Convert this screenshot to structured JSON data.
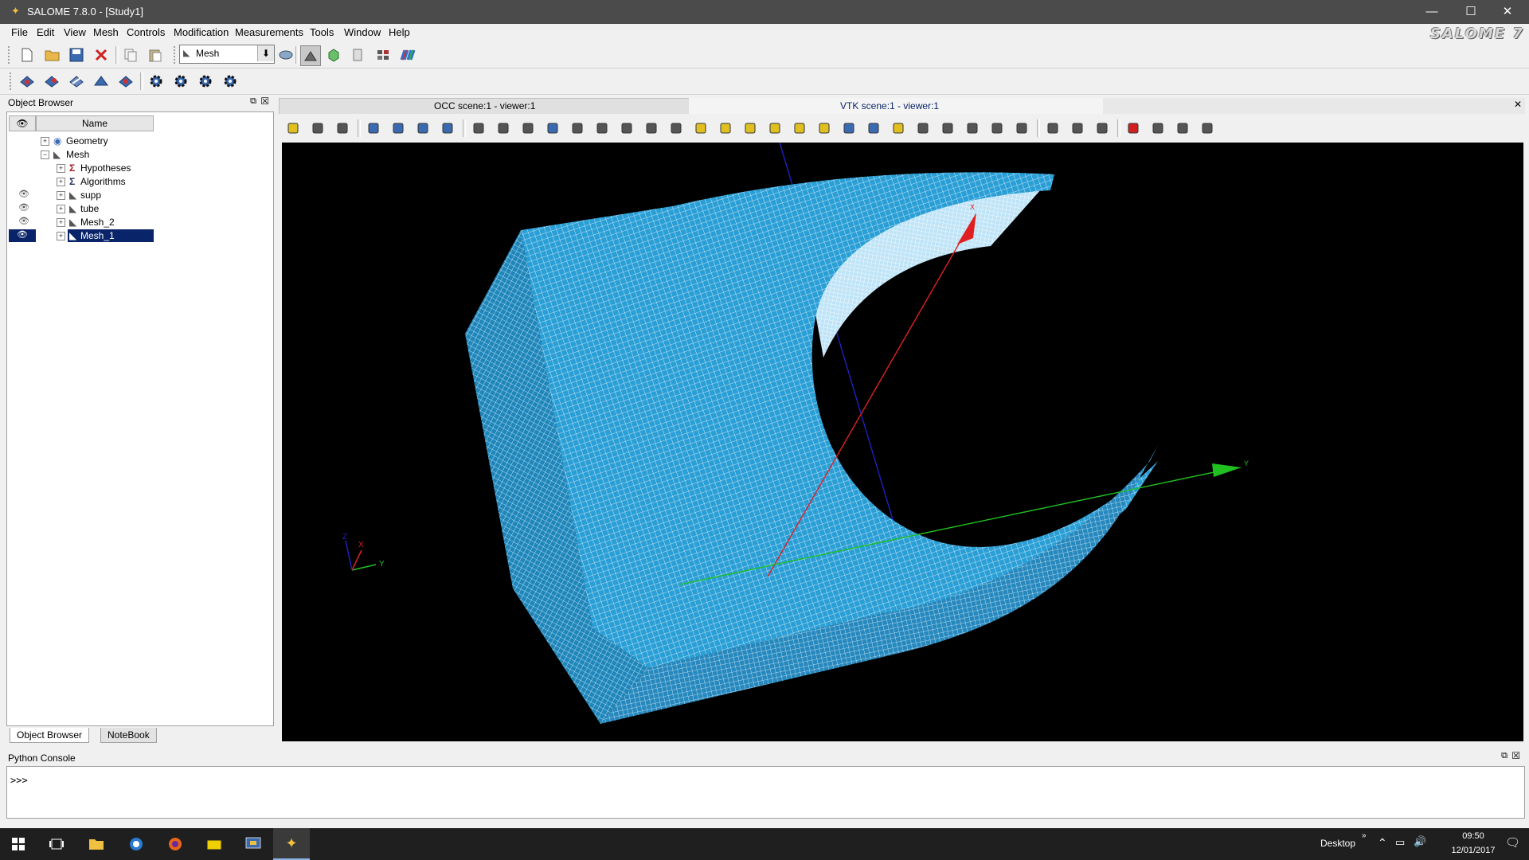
{
  "window": {
    "title": "SALOME 7.8.0 - [Study1]",
    "minimize": "—",
    "maximize": "☐",
    "close": "✕"
  },
  "menu": [
    "File",
    "Edit",
    "View",
    "Mesh",
    "Controls",
    "Modification",
    "Measurements",
    "Tools",
    "Window",
    "Help"
  ],
  "logo_text": "SALOME 7",
  "module_select": {
    "value": "Mesh"
  },
  "object_browser": {
    "title": "Object Browser",
    "column_name": "Name",
    "items": [
      {
        "label": "Geometry",
        "level": 0,
        "expanded": false,
        "visible_eye": false
      },
      {
        "label": "Mesh",
        "level": 0,
        "expanded": true,
        "visible_eye": false
      },
      {
        "label": "Hypotheses",
        "level": 1,
        "expanded": false,
        "visible_eye": false
      },
      {
        "label": "Algorithms",
        "level": 1,
        "expanded": false,
        "visible_eye": false
      },
      {
        "label": "supp",
        "level": 1,
        "expanded": false,
        "visible_eye": true
      },
      {
        "label": "tube",
        "level": 1,
        "expanded": false,
        "visible_eye": true
      },
      {
        "label": "Mesh_2",
        "level": 1,
        "expanded": false,
        "visible_eye": true
      },
      {
        "label": "Mesh_1",
        "level": 1,
        "expanded": false,
        "visible_eye": true,
        "selected": true
      }
    ],
    "tabs": [
      "Object Browser",
      "NoteBook"
    ]
  },
  "viewer": {
    "tabs": [
      "OCC scene:1 - viewer:1",
      "VTK scene:1 - viewer:1"
    ],
    "active_tab": 1,
    "axes": {
      "x": "X",
      "y": "Y",
      "z": "Z"
    }
  },
  "python_console": {
    "title": "Python Console",
    "prompt": ">>>"
  },
  "taskbar": {
    "desktop_label": "Desktop",
    "time": "09:50",
    "date": "12/01/2017"
  },
  "colors": {
    "mesh": "#2a9fd6",
    "axis_x": "#e02020",
    "axis_y": "#20c020",
    "axis_z": "#2020c0",
    "selection": "#0a246a"
  }
}
